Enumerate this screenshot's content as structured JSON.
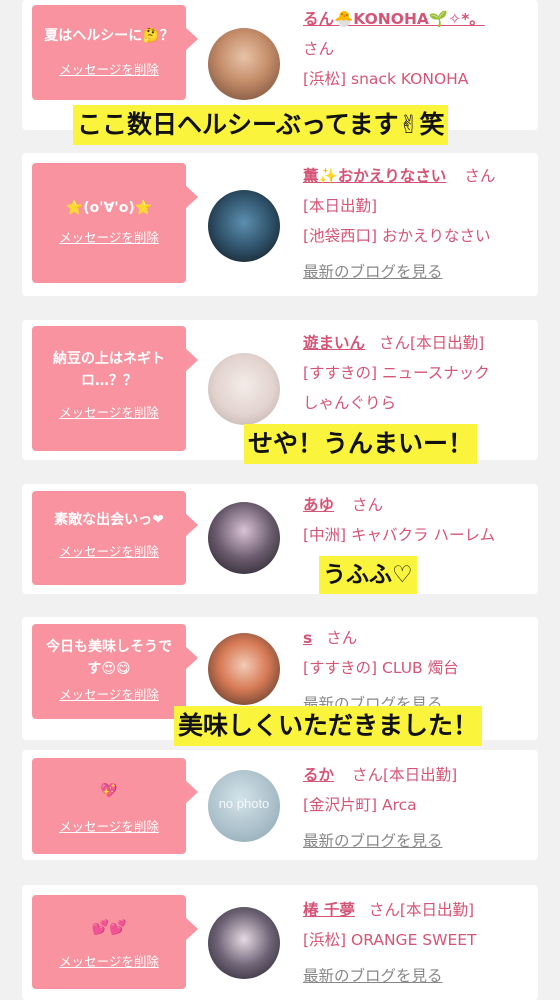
{
  "delete_label": "メッセージを削除",
  "blog_label": "最新のブログを見る",
  "san": "さん",
  "colors": {
    "bubble": "#f8939f",
    "name": "#d55576",
    "caption_bg": "#fbf43c"
  },
  "cards": [
    {
      "message": "夏はヘルシーに🤔？",
      "name": "るん🐣KONOHA🌱✧*。",
      "line1": "",
      "line2": "[浜松] snack KONOHA",
      "line3": ""
    },
    {
      "message": "⭐(o'∀'o)⭐",
      "name": "薫✨おかえりなさい",
      "line1": "",
      "line2": "[本日出勤]",
      "line3": "[池袋西口] おかえりなさい"
    },
    {
      "message": "納豆の上はネギトロ…？？",
      "name": "遊まいん",
      "line1": "[本日出勤]",
      "line2": "[すすきの] ニュースナック",
      "line3": "しゃんぐりら"
    },
    {
      "message": "素敵な出会いっ❤",
      "name": "あゆ",
      "line1": "",
      "line2": "[中洲] キャバクラ ハーレム",
      "line3": ""
    },
    {
      "message": "今日も美味しそうです😍😋",
      "name": "s",
      "line1": "",
      "line2": "[すすきの] CLUB 燭台",
      "line3": ""
    },
    {
      "message": "💖",
      "name": "るか",
      "line1": "[本日出勤]",
      "line2": "[金沢片町] Arca",
      "line3": ""
    },
    {
      "message": "💕💕",
      "name": "椿 千夢",
      "line1": "[本日出勤]",
      "line2": "[浜松] ORANGE SWEET",
      "line3": ""
    }
  ],
  "captions": {
    "c1": "ここ数日ヘルシーぶってます✌笑",
    "c3": "せや！うんまいー！",
    "c4": "うふふ♡",
    "c5": "美味しくいただきました！"
  },
  "avatar_text": "no photo"
}
